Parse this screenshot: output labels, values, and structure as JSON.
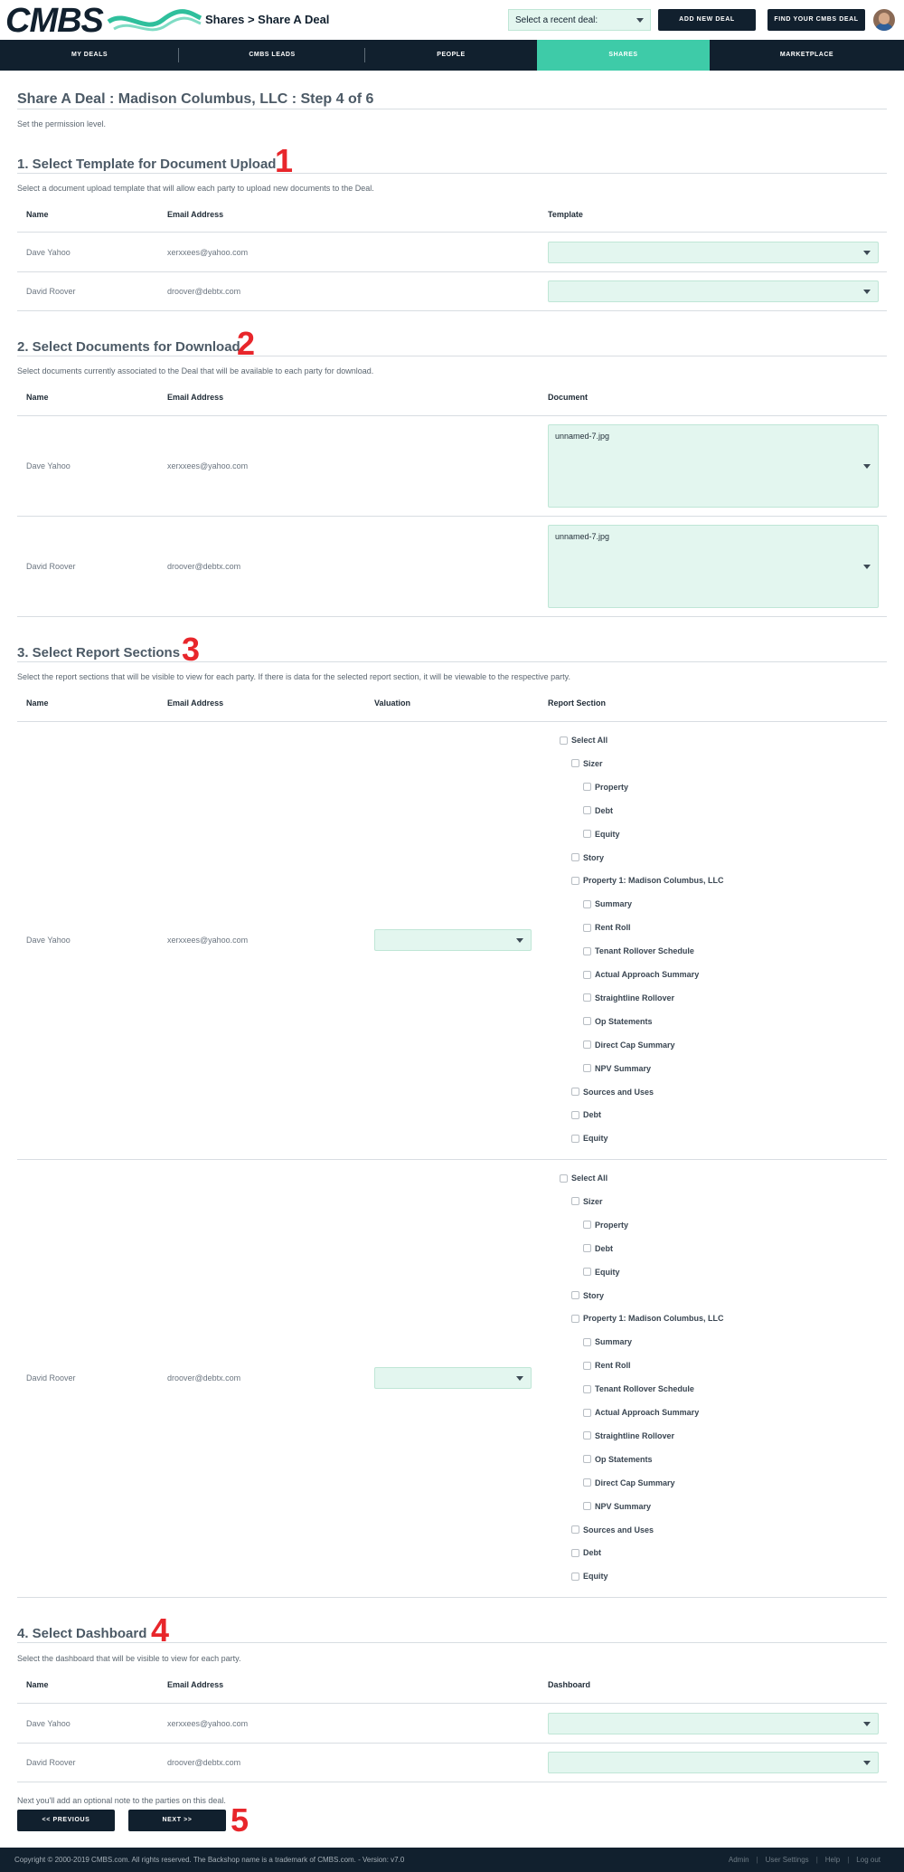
{
  "header": {
    "logo": "CMBS",
    "breadcrumb": "Shares > Share A Deal",
    "recent_deal_placeholder": "Select a recent deal:",
    "add_new_deal": "ADD NEW DEAL",
    "find_deal": "FIND YOUR CMBS DEAL"
  },
  "nav": [
    "MY DEALS",
    "CMBS LEADS",
    "PEOPLE",
    "SHARES",
    "MARKETPLACE"
  ],
  "nav_active": "SHARES",
  "page": {
    "title": "Share A Deal : Madison Columbus, LLC : Step 4 of 6",
    "subtitle": "Set the permission level."
  },
  "parties": [
    {
      "name": "Dave Yahoo",
      "email": "xerxxees@yahoo.com"
    },
    {
      "name": "David Roover",
      "email": "droover@debtx.com"
    }
  ],
  "section1": {
    "title": "1. Select Template for Document Upload",
    "desc": "Select a document upload template that will allow each party to upload new documents to the Deal.",
    "cols": [
      "Name",
      "Email Address",
      "Template"
    ],
    "marker": "1"
  },
  "section2": {
    "title": "2. Select Documents for Download",
    "desc": "Select documents currently associated to the Deal that will be available to each party for download.",
    "cols": [
      "Name",
      "Email Address",
      "Document"
    ],
    "documents": [
      "unnamed-7.jpg",
      "unnamed-7.jpg"
    ],
    "marker": "2"
  },
  "section3": {
    "title": "3. Select Report Sections",
    "desc": "Select the report sections that will be visible to view for each party. If there is data for the selected report section, it will be viewable to the respective party.",
    "cols": [
      "Name",
      "Email Address",
      "Valuation",
      "Report Section"
    ],
    "report_sections": [
      {
        "label": "Select All",
        "level": 0
      },
      {
        "label": "Sizer",
        "level": 1
      },
      {
        "label": "Property",
        "level": 2
      },
      {
        "label": "Debt",
        "level": 2
      },
      {
        "label": "Equity",
        "level": 2
      },
      {
        "label": "Story",
        "level": 1
      },
      {
        "label": "Property 1: Madison Columbus, LLC",
        "level": 1
      },
      {
        "label": "Summary",
        "level": 2
      },
      {
        "label": "Rent Roll",
        "level": 2
      },
      {
        "label": "Tenant Rollover Schedule",
        "level": 2
      },
      {
        "label": "Actual Approach Summary",
        "level": 2
      },
      {
        "label": "Straightline Rollover",
        "level": 2
      },
      {
        "label": "Op Statements",
        "level": 2
      },
      {
        "label": "Direct Cap Summary",
        "level": 2
      },
      {
        "label": "NPV Summary",
        "level": 2
      },
      {
        "label": "Sources and Uses",
        "level": 1
      },
      {
        "label": "Debt",
        "level": 1
      },
      {
        "label": "Equity",
        "level": 1
      }
    ],
    "marker": "3"
  },
  "section4": {
    "title": "4. Select Dashboard",
    "desc": "Select the dashboard that will be visible to view for each party.",
    "cols": [
      "Name",
      "Email Address",
      "Dashboard"
    ],
    "marker": "4"
  },
  "next_note": "Next you'll add an optional note to the parties on this deal.",
  "buttons": {
    "previous": "<< PREVIOUS",
    "next": "NEXT >>",
    "marker": "5"
  },
  "footer": {
    "copyright": "Copyright © 2000-2019 CMBS.com. All rights reserved. The Backshop name is a trademark of CMBS.com. - Version: v7.0",
    "links": [
      "Admin",
      "User Settings",
      "Help",
      "Log out"
    ]
  },
  "colors": {
    "navy": "#11202e",
    "teal": "#3ecba8",
    "field": "#e3f6ef",
    "marker_red": "#e8262b"
  },
  "icons": [
    "chevron-down-icon",
    "checkbox-icon",
    "avatar"
  ]
}
